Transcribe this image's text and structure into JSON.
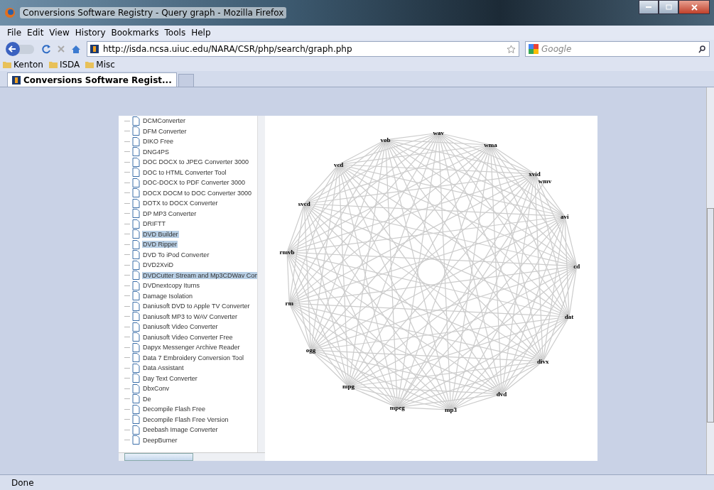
{
  "window": {
    "title": "Conversions Software Registry - Query graph - Mozilla Firefox"
  },
  "menu": [
    "File",
    "Edit",
    "View",
    "History",
    "Bookmarks",
    "Tools",
    "Help"
  ],
  "address": {
    "value": "http://isda.ncsa.uiuc.edu/NARA/CSR/php/search/graph.php"
  },
  "search": {
    "placeholder": "Google"
  },
  "bookmarks": [
    "Kenton",
    "ISDA",
    "Misc"
  ],
  "tabs": [
    {
      "label": "Conversions Software Regist...",
      "selected": true
    }
  ],
  "tree": [
    {
      "label": "DCMConverter",
      "selected": false
    },
    {
      "label": "DFM Converter",
      "selected": false
    },
    {
      "label": "DIKO Free",
      "selected": false
    },
    {
      "label": "DNG4PS",
      "selected": false
    },
    {
      "label": "DOC DOCX to JPEG Converter 3000",
      "selected": false
    },
    {
      "label": "DOC to HTML Converter Tool",
      "selected": false
    },
    {
      "label": "DOC-DOCX to PDF Converter 3000",
      "selected": false
    },
    {
      "label": "DOCX DOCM to DOC Converter 3000",
      "selected": false
    },
    {
      "label": "DOTX to DOCX Converter",
      "selected": false
    },
    {
      "label": "DP MP3 Converter",
      "selected": false
    },
    {
      "label": "DRIFTT",
      "selected": false
    },
    {
      "label": "DVD Builder",
      "selected": true
    },
    {
      "label": "DVD Ripper",
      "selected": true
    },
    {
      "label": "DVD To iPod Converter",
      "selected": false
    },
    {
      "label": "DVD2XviD",
      "selected": false
    },
    {
      "label": "DVDCutter Stream and Mp3CDWav Con",
      "selected": true
    },
    {
      "label": "DVDnextcopy Iturns",
      "selected": false
    },
    {
      "label": "Damage Isolation",
      "selected": false
    },
    {
      "label": "Daniusoft DVD to Apple TV Converter",
      "selected": false
    },
    {
      "label": "Daniusoft MP3 to WAV Converter",
      "selected": false
    },
    {
      "label": "Daniusoft Video Converter",
      "selected": false
    },
    {
      "label": "Daniusoft Video Converter Free",
      "selected": false
    },
    {
      "label": "Dapyx Messenger Archive Reader",
      "selected": false
    },
    {
      "label": "Data 7 Embroidery Conversion Tool",
      "selected": false
    },
    {
      "label": "Data Assistant",
      "selected": false
    },
    {
      "label": "Day Text Converter",
      "selected": false
    },
    {
      "label": "DbxConv",
      "selected": false
    },
    {
      "label": "De",
      "selected": false
    },
    {
      "label": "Decompile Flash Free",
      "selected": false
    },
    {
      "label": "Decompile Flash Free Version",
      "selected": false
    },
    {
      "label": "Deebash Image Converter",
      "selected": false
    },
    {
      "label": "DeepBurner",
      "selected": false
    }
  ],
  "graph": {
    "nodes": [
      {
        "label": "wav",
        "kind": "ring"
      },
      {
        "label": "wma",
        "kind": "ring"
      },
      {
        "label": "wmv",
        "kind": "satellite"
      },
      {
        "label": "xvid",
        "kind": "ring"
      },
      {
        "label": "avi",
        "kind": "ring"
      },
      {
        "label": "cd",
        "kind": "ring"
      },
      {
        "label": "dat",
        "kind": "ring"
      },
      {
        "label": "divx",
        "kind": "ring"
      },
      {
        "label": "dvd",
        "kind": "ring"
      },
      {
        "label": "mp3",
        "kind": "ring"
      },
      {
        "label": "mpeg",
        "kind": "ring"
      },
      {
        "label": "mpg",
        "kind": "ring"
      },
      {
        "label": "ogg",
        "kind": "ring"
      },
      {
        "label": "rm",
        "kind": "ring"
      },
      {
        "label": "rmvb",
        "kind": "ring"
      },
      {
        "label": "svcd",
        "kind": "ring"
      },
      {
        "label": "vcd",
        "kind": "ring"
      },
      {
        "label": "vob",
        "kind": "ring"
      }
    ]
  },
  "status_bar": {
    "text": "Done"
  }
}
